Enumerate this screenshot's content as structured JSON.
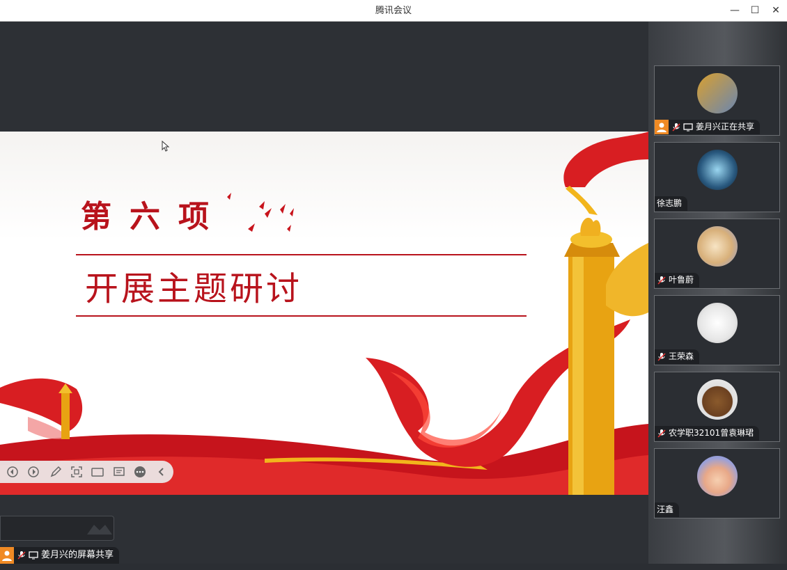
{
  "window": {
    "title": "腾讯会议",
    "minimize": "—",
    "maximize": "☐",
    "close": "✕"
  },
  "slide": {
    "heading": "第六项",
    "subtitle": "开展主题研讨"
  },
  "toolbar": {
    "buttons": [
      "prev-page-icon",
      "next-page-icon",
      "pen-icon",
      "screenshot-icon",
      "camera-icon",
      "comment-icon",
      "more-icon",
      "collapse-icon"
    ]
  },
  "participants": [
    {
      "name": "姜月兴正在共享",
      "sharing": true,
      "muted": true
    },
    {
      "name": "徐志鹏",
      "sharing": false,
      "muted": false
    },
    {
      "name": "叶鲁蔚",
      "sharing": false,
      "muted": true
    },
    {
      "name": "王荣森",
      "sharing": false,
      "muted": true
    },
    {
      "name": "农学职32101曾袁琳珺",
      "sharing": false,
      "muted": true
    },
    {
      "name": "汪鑫",
      "sharing": false,
      "muted": false
    }
  ],
  "share_status": {
    "label": "姜月兴的屏幕共享"
  },
  "colors": {
    "brand_red": "#b8131c",
    "share_orange": "#f08a24"
  }
}
